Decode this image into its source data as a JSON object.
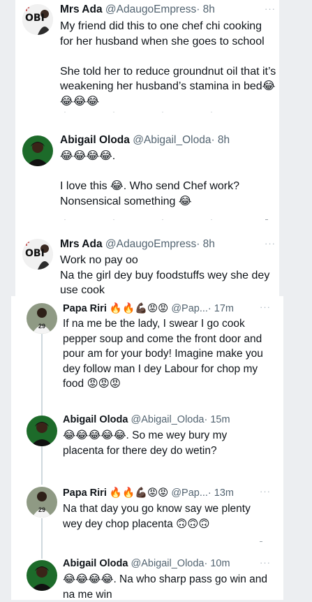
{
  "tweets": [
    {
      "name": "Mrs Ada",
      "handle": "@AdaugoEmpress",
      "time": "· 8h",
      "text": "My friend did this to one chef chi cooking for her husband when she goes to school\n\nShe told her to reduce groundnut oil that it’s weakening her husband’s stamina in bed😂😂😂😂",
      "avatar_text": "OBI"
    },
    {
      "name": "Abigail Oloda",
      "handle": "@Abigail_Oloda",
      "time": "· 8h",
      "text": "😂😂😂😂.\n\nI love this 😂. Who send Chef work?\nNonsensical something 😂"
    },
    {
      "name": "Mrs Ada",
      "handle": "@AdaugoEmpress",
      "time": "· 8h",
      "text": "Work no pay oo\nNa the girl dey buy foodstuffs wey she dey use cook",
      "avatar_text": "OBI"
    },
    {
      "name": "Papa Riri 🔥🔥💪🏿😡😡",
      "handle": "@Pap...",
      "time": "· 17m",
      "text": "If na me be the lady, I swear I go cook pepper soup and come the front door and pour am for your body! Imagine make you dey follow man I dey Labour for chop my food 😡😡😡",
      "avatar_text": "29"
    },
    {
      "name": "Abigail Oloda",
      "handle": "@Abigail_Oloda",
      "time": "· 15m",
      "text": "😂😂😂😂😂. So me wey bury my placenta for there dey do wetin?"
    },
    {
      "name": "Papa Riri 🔥🔥💪🏿😡😡",
      "handle": "@Pap...",
      "time": "· 13m",
      "text": "Na that day you go know say we plenty wey dey chop placenta 🙃🙃🙃",
      "avatar_text": "29"
    },
    {
      "name": "Abigail Oloda",
      "handle": "@Abigail_Oloda",
      "time": "· 10m",
      "text": "😂😂😂😂. Na who sharp pass go win and na me win"
    }
  ],
  "more_label": "···"
}
